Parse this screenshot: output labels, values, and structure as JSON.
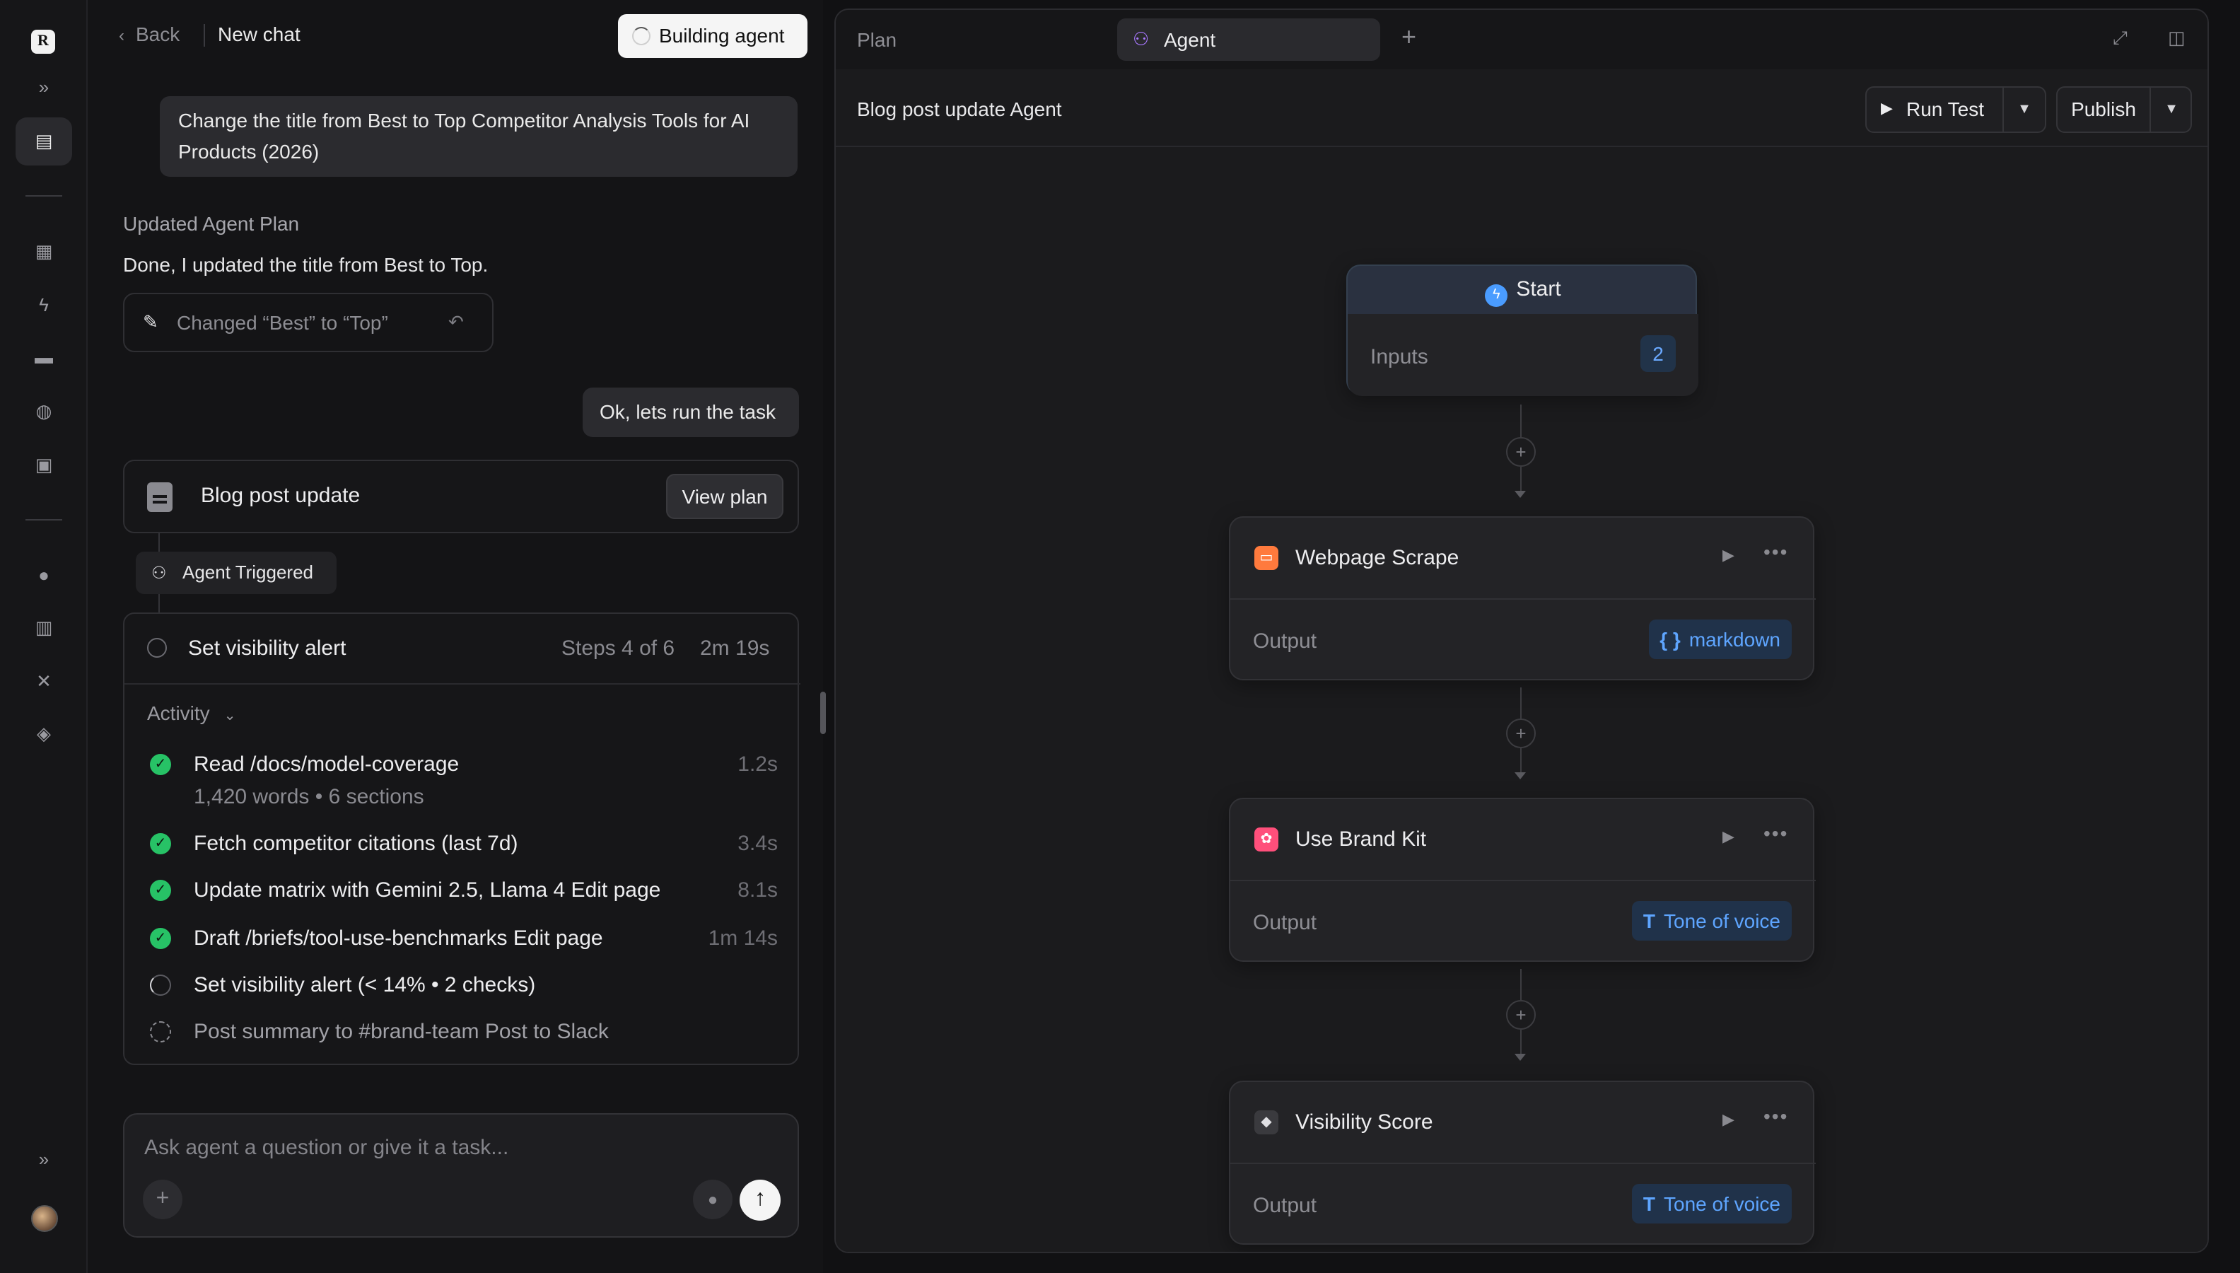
{
  "rail": {
    "logo_letter": "R",
    "icons": [
      "forward-icon",
      "inbox-icon",
      "grid-icon",
      "bolt-icon",
      "chat-icon",
      "globe-icon",
      "lock-icon",
      "bulb-icon",
      "book-icon",
      "tools-icon",
      "layers-icon",
      "expand-icon"
    ]
  },
  "chat": {
    "back_label": "Back",
    "chat_title": "New chat",
    "building_label": "Building agent",
    "user_message_1": "Change the title from Best to Top Competitor Analysis Tools for AI Products (2026)",
    "plan_heading": "Updated Agent Plan",
    "plan_reply": "Done, I updated the title from Best to Top.",
    "change_label": "Changed “Best” to “Top”",
    "user_message_2": "Ok, lets run the task",
    "task_title": "Blog post update",
    "view_plan_label": "View plan",
    "trigger_label": "Agent Triggered",
    "current_step": {
      "name": "Set visibility alert",
      "steps": "Steps 4 of 6",
      "elapsed": "2m 19s"
    },
    "activity_label": "Activity",
    "activity": [
      {
        "status": "done",
        "label": "Read /docs/model-coverage",
        "sub": "1,420 words • 6 sections",
        "time": "1.2s"
      },
      {
        "status": "done",
        "label": "Fetch competitor citations (last 7d)",
        "time": "3.4s"
      },
      {
        "status": "done",
        "label": "Update matrix with Gemini 2.5, Llama 4 Edit page",
        "time": "8.1s"
      },
      {
        "status": "done",
        "label": "Draft /briefs/tool-use-benchmarks Edit page",
        "time": "1m 14s"
      },
      {
        "status": "running",
        "label": "Set visibility alert (< 14% • 2 checks)",
        "time": ""
      },
      {
        "status": "pending",
        "label": "Post summary to #brand-team Post to Slack",
        "time": ""
      }
    ],
    "composer_placeholder": "Ask agent a question or give it a task..."
  },
  "panel": {
    "tab_plan": "Plan",
    "tab_agent": "Agent",
    "agent_title": "Blog post update Agent",
    "run_test_label": "Run Test",
    "publish_label": "Publish",
    "start": {
      "label": "Start",
      "inputs_label": "Inputs",
      "inputs_count": "2"
    },
    "steps": [
      {
        "name": "Webpage Scrape",
        "output_label": "Output",
        "output_type": "markdown",
        "output_icon": "{ }",
        "icon_color": "#ff7a3d"
      },
      {
        "name": "Use Brand Kit",
        "output_label": "Output",
        "output_type": "Tone of voice",
        "output_icon": "T",
        "icon_color": "#ff4f7b"
      },
      {
        "name": "Visibility Score",
        "output_label": "Output",
        "output_type": "Tone of voice",
        "output_icon": "T",
        "icon_color": "#d0d0d4"
      }
    ]
  }
}
